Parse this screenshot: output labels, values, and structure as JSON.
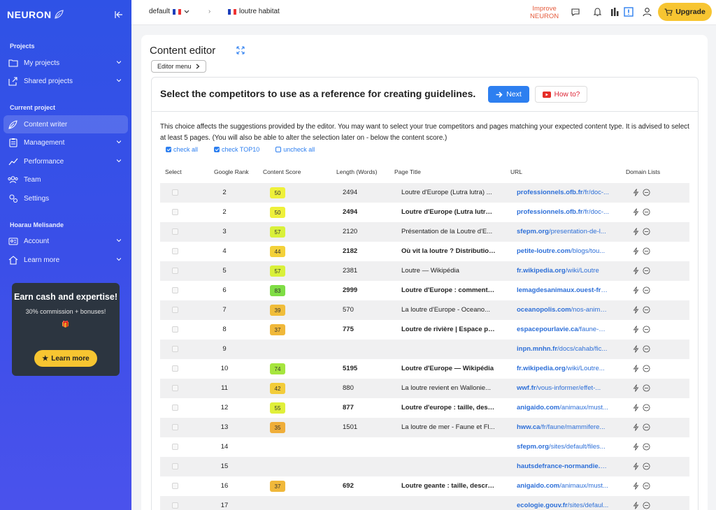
{
  "sidebar": {
    "logo": "NEURON",
    "sections": {
      "projects": "Projects",
      "current": "Current project",
      "user": "Hoarau Melisande"
    },
    "items": [
      {
        "label": "My projects",
        "icon": "folder-icon"
      },
      {
        "label": "Shared projects",
        "icon": "share-icon"
      },
      {
        "label": "Content writer",
        "icon": "feather-icon"
      },
      {
        "label": "Management",
        "icon": "clipboard-icon"
      },
      {
        "label": "Performance",
        "icon": "chart-icon"
      },
      {
        "label": "Team",
        "icon": "team-icon"
      },
      {
        "label": "Settings",
        "icon": "settings-icon"
      },
      {
        "label": "Account",
        "icon": "id-card-icon"
      },
      {
        "label": "Learn more",
        "icon": "learn-icon"
      }
    ],
    "promo": {
      "title": "Earn cash and expertise!",
      "subtitle": "30% commission + bonuses!",
      "button": "Learn more"
    }
  },
  "topbar": {
    "workspace": "default",
    "project": "loutre habitat",
    "improve_line1": "Improve",
    "improve_line2": "NEURON",
    "upgrade": "Upgrade"
  },
  "main": {
    "title": "Content editor",
    "editor_menu": "Editor menu",
    "headline": "Select the competitors to use as a reference for creating guidelines.",
    "next": "Next",
    "howto": "How to?",
    "description": "This choice affects the suggestions provided by the editor. You may want to select your true competitors and pages matching your expected content type. It is advised to select at least 5 pages. (You will also be able to alter the selection later on - below the content score.)",
    "check_all": "check all",
    "check_top10": "check TOP10",
    "uncheck_all": "uncheck all",
    "columns": {
      "select": "Select",
      "rank": "Google Rank",
      "score": "Content Score",
      "length": "Length (Words)",
      "title": "Page Title",
      "url": "URL",
      "domain": "Domain Lists"
    },
    "rows": [
      {
        "rank": "2",
        "score": "50",
        "color": "#eef03a",
        "length": "2494",
        "title": "Loutre d'Europe (Lutra lutra) ...",
        "domain": "professionnels.ofb.fr",
        "path": "/fr/doc-...",
        "bold": false
      },
      {
        "rank": "2",
        "score": "50",
        "color": "#eef03a",
        "length": "2494",
        "title": "Loutre d'Europe (Lutra lutra) ...",
        "domain": "professionnels.ofb.fr",
        "path": "/fr/doc-...",
        "bold": true
      },
      {
        "rank": "3",
        "score": "57",
        "color": "#d9f03a",
        "length": "2120",
        "title": "Présentation de la Loutre d'E...",
        "domain": "sfepm.org",
        "path": "/presentation-de-l...",
        "bold": false
      },
      {
        "rank": "4",
        "score": "44",
        "color": "#f3d13a",
        "length": "2182",
        "title": "Où vit la loutre ? Distribution...",
        "domain": "petite-loutre.com",
        "path": "/blogs/tou...",
        "bold": true
      },
      {
        "rank": "5",
        "score": "57",
        "color": "#d9f03a",
        "length": "2381",
        "title": "Loutre — Wikipédia",
        "domain": "fr.wikipedia.org",
        "path": "/wiki/Loutre",
        "bold": false
      },
      {
        "rank": "6",
        "score": "83",
        "color": "#7fdd45",
        "length": "2999",
        "title": "Loutre d'Europe : comment e...",
        "domain": "lemagdesanimaux.ouest-fra...",
        "path": "",
        "bold": true
      },
      {
        "rank": "7",
        "score": "39",
        "color": "#f0bd3a",
        "length": "570",
        "title": "La loutre d'Europe - Oceano...",
        "domain": "oceanopolis.com",
        "path": "/nos-anima...",
        "bold": false
      },
      {
        "rank": "8",
        "score": "37",
        "color": "#f0b83a",
        "length": "775",
        "title": "Loutre de rivière | Espace po...",
        "domain": "espacepourlavie.ca",
        "path": "/faune-bi...",
        "bold": true
      },
      {
        "rank": "9",
        "score": "",
        "color": "",
        "length": "",
        "title": "",
        "domain": "inpn.mnhn.fr",
        "path": "/docs/cahab/fic...",
        "bold": false
      },
      {
        "rank": "10",
        "score": "74",
        "color": "#a6e53e",
        "length": "5195",
        "title": "Loutre d'Europe — Wikipédia",
        "domain": "fr.wikipedia.org",
        "path": "/wiki/Loutre...",
        "bold": true
      },
      {
        "rank": "11",
        "score": "42",
        "color": "#f2cc3a",
        "length": "880",
        "title": "La loutre revient en Wallonie...",
        "domain": "wwf.fr",
        "path": "/vous-informer/effet-...",
        "bold": false
      },
      {
        "rank": "12",
        "score": "55",
        "color": "#e0ef3a",
        "length": "877",
        "title": "Loutre d'europe : taille, descr...",
        "domain": "anigaido.com",
        "path": "/animaux/must...",
        "bold": true
      },
      {
        "rank": "13",
        "score": "35",
        "color": "#efae3a",
        "length": "1501",
        "title": "La loutre de mer - Faune et Fl...",
        "domain": "hww.ca",
        "path": "/fr/faune/mammifere...",
        "bold": false
      },
      {
        "rank": "14",
        "score": "",
        "color": "",
        "length": "",
        "title": "",
        "domain": "sfepm.org",
        "path": "/sites/default/files...",
        "bold": true
      },
      {
        "rank": "15",
        "score": "",
        "color": "",
        "length": "",
        "title": "",
        "domain": "hautsdefrance-normandie.c...",
        "path": "",
        "bold": false
      },
      {
        "rank": "16",
        "score": "37",
        "color": "#f0b83a",
        "length": "692",
        "title": "Loutre geante : taille, descrip...",
        "domain": "anigaido.com",
        "path": "/animaux/must...",
        "bold": true
      },
      {
        "rank": "17",
        "score": "",
        "color": "",
        "length": "",
        "title": "",
        "domain": "ecologie.gouv.fr",
        "path": "/sites/defaul...",
        "bold": false
      }
    ]
  }
}
